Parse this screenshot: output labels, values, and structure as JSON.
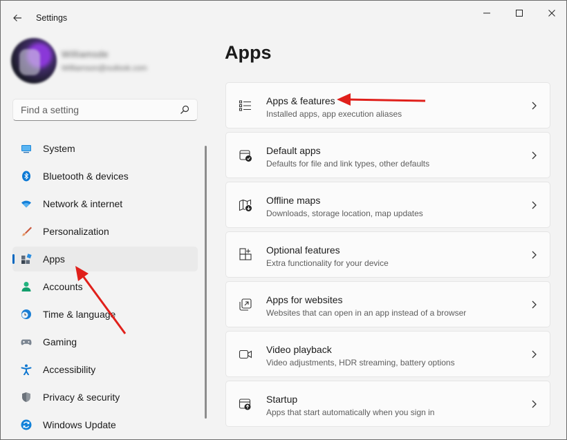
{
  "window": {
    "title": "Settings",
    "back_icon": "arrow-left-icon",
    "controls": [
      "minimize-icon",
      "maximize-icon",
      "close-icon"
    ]
  },
  "profile": {
    "name": "Williamsde",
    "email": "Williamson@outlook.com"
  },
  "search": {
    "placeholder": "Find a setting",
    "icon": "search-icon"
  },
  "nav": {
    "items": [
      {
        "label": "System",
        "icon": "monitor-icon"
      },
      {
        "label": "Bluetooth & devices",
        "icon": "bluetooth-icon"
      },
      {
        "label": "Network & internet",
        "icon": "wifi-icon"
      },
      {
        "label": "Personalization",
        "icon": "brush-icon"
      },
      {
        "label": "Apps",
        "icon": "apps-icon",
        "selected": true
      },
      {
        "label": "Accounts",
        "icon": "person-icon"
      },
      {
        "label": "Time & language",
        "icon": "globe-clock-icon"
      },
      {
        "label": "Gaming",
        "icon": "gamepad-icon"
      },
      {
        "label": "Accessibility",
        "icon": "accessibility-icon"
      },
      {
        "label": "Privacy & security",
        "icon": "shield-icon"
      },
      {
        "label": "Windows Update",
        "icon": "update-icon"
      }
    ]
  },
  "main": {
    "title": "Apps",
    "cards": [
      {
        "title": "Apps & features",
        "desc": "Installed apps, app execution aliases",
        "icon": "list-icon"
      },
      {
        "title": "Default apps",
        "desc": "Defaults for file and link types, other defaults",
        "icon": "default-apps-icon"
      },
      {
        "title": "Offline maps",
        "desc": "Downloads, storage location, map updates",
        "icon": "map-download-icon"
      },
      {
        "title": "Optional features",
        "desc": "Extra functionality for your device",
        "icon": "grid-add-icon"
      },
      {
        "title": "Apps for websites",
        "desc": "Websites that can open in an app instead of a browser",
        "icon": "open-in-app-icon"
      },
      {
        "title": "Video playback",
        "desc": "Video adjustments, HDR streaming, battery options",
        "icon": "video-camera-icon"
      },
      {
        "title": "Startup",
        "desc": "Apps that start automatically when you sign in",
        "icon": "startup-icon"
      }
    ]
  },
  "colors": {
    "accent": "#0067c0",
    "annotation_arrow": "#e0201b",
    "background": "#f3f3f3",
    "card": "#fbfbfb"
  }
}
